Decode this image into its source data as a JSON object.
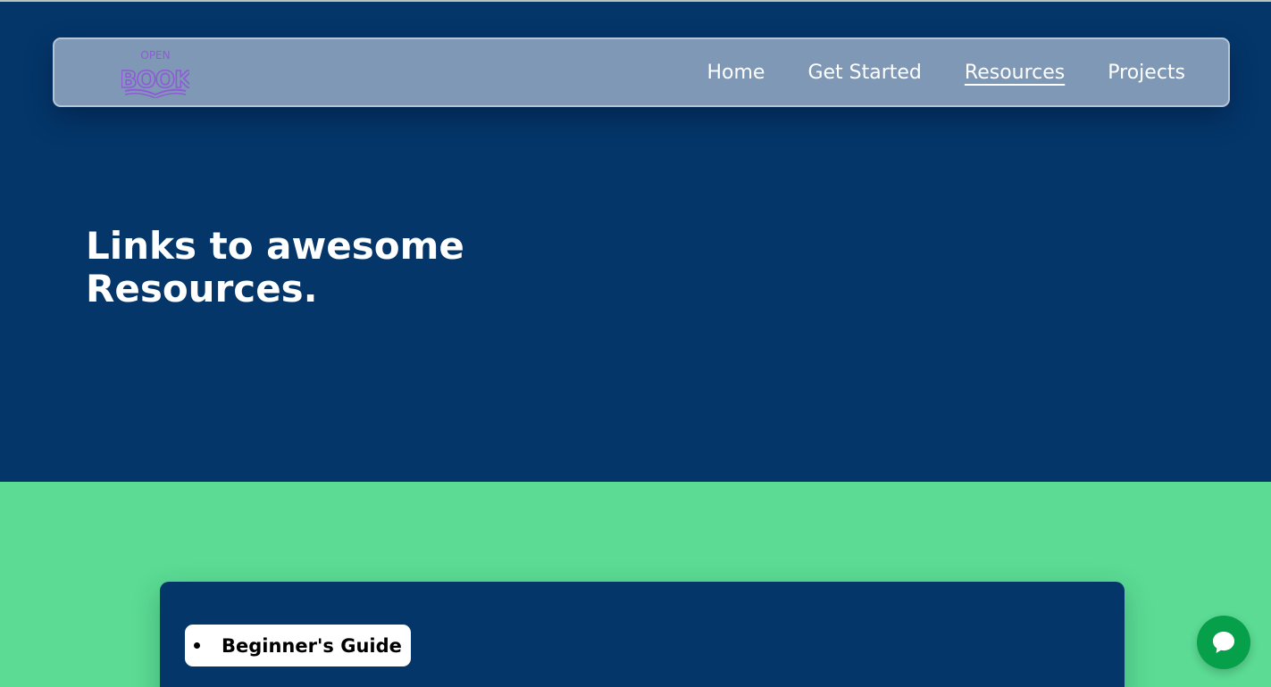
{
  "colors": {
    "hero_bg": "#04366a",
    "page_bg": "#5bdb94",
    "nav_bg": "#7f98b5",
    "logo_accent": "#8e5bd6",
    "chat_button": "#07a04a"
  },
  "logo": {
    "alt": "Open Book logo",
    "text_top": "OPEN",
    "text_main": "BOOK"
  },
  "nav": {
    "links": [
      {
        "label": "Home",
        "active": false
      },
      {
        "label": "Get Started",
        "active": false
      },
      {
        "label": "Resources",
        "active": true
      },
      {
        "label": "Projects",
        "active": false
      }
    ]
  },
  "hero": {
    "title_line1": "Links to awesome",
    "title_line2": "Resources."
  },
  "resources": {
    "items": [
      {
        "label": "Beginner's Guide"
      }
    ]
  },
  "chat": {
    "icon": "chat-bubble-icon"
  }
}
